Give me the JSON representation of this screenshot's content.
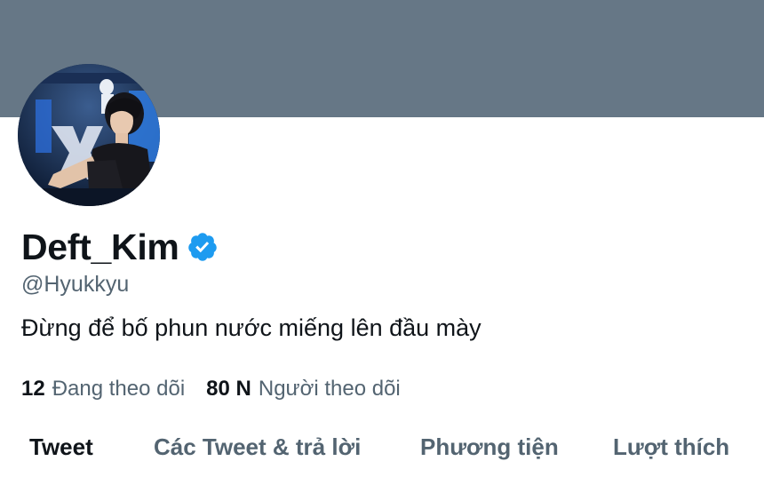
{
  "profile": {
    "display_name": "Deft_Kim",
    "verified": true,
    "handle": "@Hyukkyu",
    "bio": "Đừng để bố phun nước miếng lên đầu mày",
    "avatar_icon": "profile-photo",
    "verified_icon": "verified-badge-icon"
  },
  "stats": {
    "following_count": "12",
    "following_label": "Đang theo dõi",
    "followers_count": "80 N",
    "followers_label": "Người theo dõi"
  },
  "tabs": [
    {
      "label": "Tweet",
      "active": true
    },
    {
      "label": "Các Tweet & trả lời",
      "active": false
    },
    {
      "label": "Phương tiện",
      "active": false
    },
    {
      "label": "Lượt thích",
      "active": false
    }
  ],
  "colors": {
    "banner": "#667786",
    "verified": "#1d9bf0",
    "primary_text": "#0f1419",
    "secondary_text": "#536471"
  }
}
